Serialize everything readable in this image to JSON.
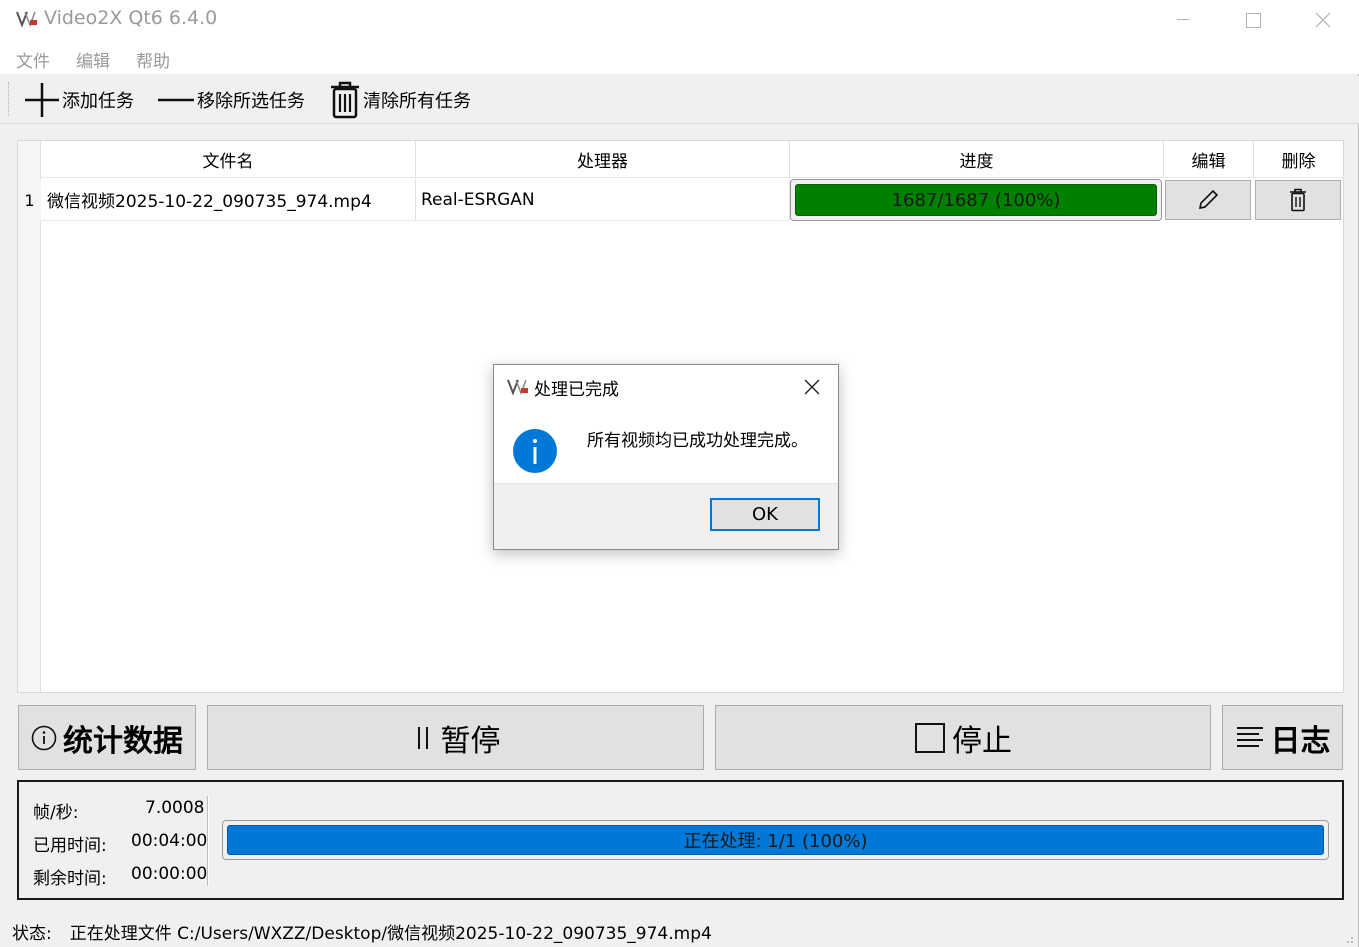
{
  "window": {
    "title": "Video2X Qt6 6.4.0"
  },
  "menu": [
    "文件",
    "编辑",
    "帮助"
  ],
  "toolbar": {
    "add_label": "添加任务",
    "remove_label": "移除所选任务",
    "clear_label": "清除所有任务"
  },
  "table": {
    "headers": {
      "filename": "文件名",
      "processor": "处理器",
      "progress": "进度",
      "edit": "编辑",
      "delete": "删除"
    },
    "rows": [
      {
        "index": "1",
        "filename": "微信视频2025-10-22_090735_974.mp4",
        "processor": "Real-ESRGAN",
        "progress_text": "1687/1687 (100%)",
        "progress_fraction": 1.0
      }
    ]
  },
  "buttons": {
    "stats": "统计数据",
    "pause": "暂停",
    "stop": "停止",
    "log": "日志"
  },
  "stats": {
    "fps_label": "帧/秒:",
    "fps_value": "7.0008",
    "elapsed_label": "已用时间:",
    "elapsed_value": "00:04:00",
    "remaining_label": "剩余时间:",
    "remaining_value": "00:00:00",
    "overall_text": "正在处理: 1/1 (100%)",
    "overall_fraction": 1.0
  },
  "status": {
    "label": "状态:",
    "text": "正在处理文件 C:/Users/WXZZ/Desktop/微信视频2025-10-22_090735_974.mp4"
  },
  "dialog": {
    "title": "处理已完成",
    "message": "所有视频均已成功处理完成。",
    "ok_label": "OK"
  },
  "colors": {
    "row_progress": "#008000",
    "overall_progress": "#0078d7",
    "dialog_accent": "#0078d7"
  },
  "icons": [
    "app-logo-icon",
    "minimize-icon",
    "maximize-icon",
    "close-icon",
    "plus-icon",
    "minus-icon",
    "trash-icon",
    "pencil-icon",
    "info-circle-icon",
    "pause-icon",
    "stop-square-icon",
    "list-lines-icon"
  ]
}
